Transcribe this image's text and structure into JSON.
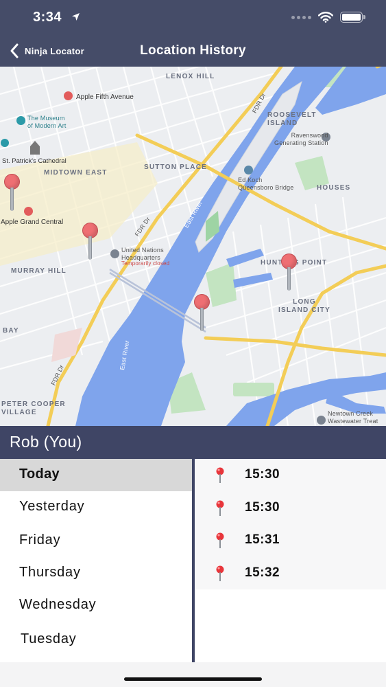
{
  "status": {
    "time": "3:34"
  },
  "nav": {
    "back_label": "Ninja Locator",
    "title": "Location History"
  },
  "map": {
    "labels": {
      "lenox_hill": "LENOX HILL",
      "roosevelt_island": "ROOSEVELT\nISLAND",
      "midtown_east": "MIDTOWN EAST",
      "sutton_place": "SUTTON PLACE",
      "houses": "HOUSES",
      "murray_hill": "MURRAY HILL",
      "hunters_point": "HUNTERS POINT",
      "long_island_city": "LONG\nISLAND CITY",
      "bay": "BAY",
      "peter_cooper_village": "PETER COOPER\nVILLAGE",
      "apple_fifth": "Apple Fifth Avenue",
      "museum": "The Museum\nof Modern Art",
      "st_patricks": "St. Patrick's Cathedral",
      "apple_grand_central": "Apple Grand Central",
      "ravenswood": "Ravenswood\nGenerating Station",
      "ed_koch": "Ed Koch\nQueensboro Bridge",
      "un_hq": "United Nations\nHeadquarters",
      "un_status": "Temporarily closed",
      "newtown_creek": "Newtown Creek\nWastewater Treat",
      "east_river_1": "East River",
      "east_river_2": "East River",
      "fdr_1": "FDR Dr",
      "fdr_2": "FDR Dr",
      "fdr_3": "FDR Dr"
    }
  },
  "user": {
    "name": "Rob (You)"
  },
  "days": [
    "Today",
    "Yesterday",
    "Friday",
    "Thursday",
    "Wednesday",
    "Tuesday"
  ],
  "selected_day": "Today",
  "times": [
    "15:30",
    "15:30",
    "15:31",
    "15:32"
  ],
  "colors": {
    "header": "#454c68",
    "accent": "#3f4565",
    "pin": "#ee6f73",
    "water": "#7fa4ec"
  }
}
